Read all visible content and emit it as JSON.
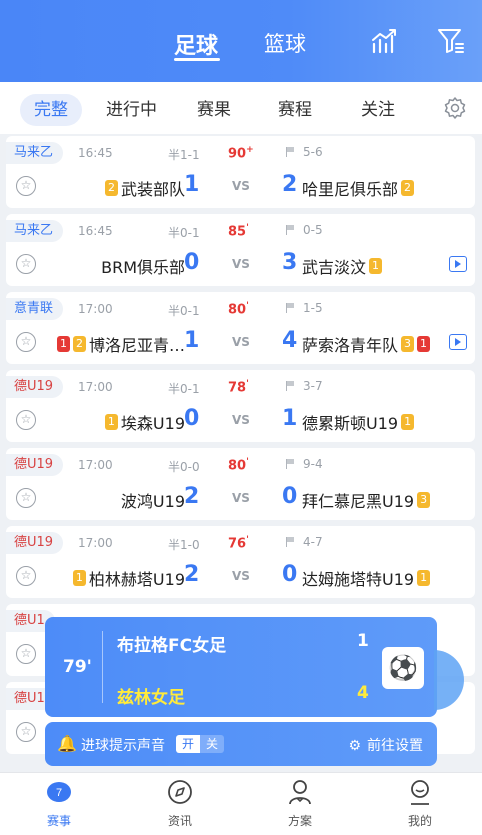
{
  "header": {
    "tabs": [
      "足球",
      "篮球"
    ],
    "icons": [
      "chart-icon",
      "filter-icon"
    ]
  },
  "filters": {
    "tabs": [
      "完整",
      "进行中",
      "赛果",
      "赛程",
      "关注"
    ],
    "settings_icon": "gear-icon"
  },
  "matches": [
    {
      "league": "马来乙",
      "league_color": "#3a78f2",
      "time": "16:45",
      "half": "半1-1",
      "minute": "90",
      "minute_sup": "+",
      "corners": "5-6",
      "home": "武装部队",
      "home_badges": [
        {
          "t": "2",
          "c": "y"
        }
      ],
      "home_score": "1",
      "away_score": "2",
      "away": "哈里尼俱乐部",
      "away_badges": [
        {
          "t": "2",
          "c": "y"
        }
      ],
      "tv": false
    },
    {
      "league": "马来乙",
      "league_color": "#3a78f2",
      "time": "16:45",
      "half": "半0-1",
      "minute": "85",
      "minute_sup": "'",
      "corners": "0-5",
      "home": "BRM俱乐部",
      "home_badges": [],
      "home_score": "0",
      "away_score": "3",
      "away": "武吉淡汶",
      "away_badges": [
        {
          "t": "1",
          "c": "y"
        }
      ],
      "tv": true
    },
    {
      "league": "意青联",
      "league_color": "#3a78f2",
      "time": "17:00",
      "half": "半0-1",
      "minute": "80",
      "minute_sup": "'",
      "corners": "1-5",
      "home": "博洛尼亚青…",
      "home_badges": [
        {
          "t": "1",
          "c": "r"
        },
        {
          "t": "2",
          "c": "y"
        }
      ],
      "home_score": "1",
      "away_score": "4",
      "away": "萨索洛青年队",
      "away_badges": [
        {
          "t": "3",
          "c": "y"
        },
        {
          "t": "1",
          "c": "r"
        }
      ],
      "tv": true
    },
    {
      "league": "德U19",
      "league_color": "#d84343",
      "time": "17:00",
      "half": "半0-1",
      "minute": "78",
      "minute_sup": "'",
      "corners": "3-7",
      "home": "埃森U19",
      "home_badges": [
        {
          "t": "1",
          "c": "y"
        }
      ],
      "home_score": "0",
      "away_score": "1",
      "away": "德累斯顿U19",
      "away_badges": [
        {
          "t": "1",
          "c": "y"
        }
      ],
      "tv": false
    },
    {
      "league": "德U19",
      "league_color": "#d84343",
      "time": "17:00",
      "half": "半0-0",
      "minute": "80",
      "minute_sup": "'",
      "corners": "9-4",
      "home": "波鸿U19",
      "home_badges": [],
      "home_score": "2",
      "away_score": "0",
      "away": "拜仁慕尼黑U19",
      "away_badges": [
        {
          "t": "3",
          "c": "y"
        }
      ],
      "tv": false
    },
    {
      "league": "德U19",
      "league_color": "#d84343",
      "time": "17:00",
      "half": "半1-0",
      "minute": "76",
      "minute_sup": "'",
      "corners": "4-7",
      "home": "柏林赫塔U19",
      "home_badges": [
        {
          "t": "1",
          "c": "y"
        }
      ],
      "home_score": "2",
      "away_score": "0",
      "away": "达姆施塔特U19",
      "away_badges": [
        {
          "t": "1",
          "c": "y"
        }
      ],
      "tv": false
    },
    {
      "league": "德U1",
      "league_color": "#d84343",
      "time": "",
      "half": "",
      "minute": "",
      "minute_sup": "",
      "corners": "",
      "home": "",
      "home_badges": [],
      "home_score": "",
      "away_score": "",
      "away": "",
      "away_badges": [],
      "tv": false
    },
    {
      "league": "德U1",
      "league_color": "#d84343",
      "time": "",
      "half": "",
      "minute": "",
      "minute_sup": "",
      "corners": "",
      "home": "",
      "home_badges": [],
      "home_score": "",
      "away_score": "",
      "away": "",
      "away_badges": [],
      "tv": false
    }
  ],
  "goal_popup": {
    "minute": "79'",
    "home": "布拉格FC女足",
    "home_score": "1",
    "away": "兹林女足",
    "away_score": "4"
  },
  "sound_bar": {
    "label": "进球提示声音",
    "on": "开",
    "off": "关",
    "goto": "前往设置"
  },
  "bottom_nav": [
    {
      "label": "赛事",
      "icon": "match-icon",
      "active": true
    },
    {
      "label": "资讯",
      "icon": "compass-icon",
      "active": false
    },
    {
      "label": "方案",
      "icon": "expert-icon",
      "active": false
    },
    {
      "label": "我的",
      "icon": "profile-icon",
      "active": false
    }
  ],
  "colors": {
    "accent": "#3a78f2",
    "red": "#e53935",
    "yellow_card": "#f5b82e"
  }
}
